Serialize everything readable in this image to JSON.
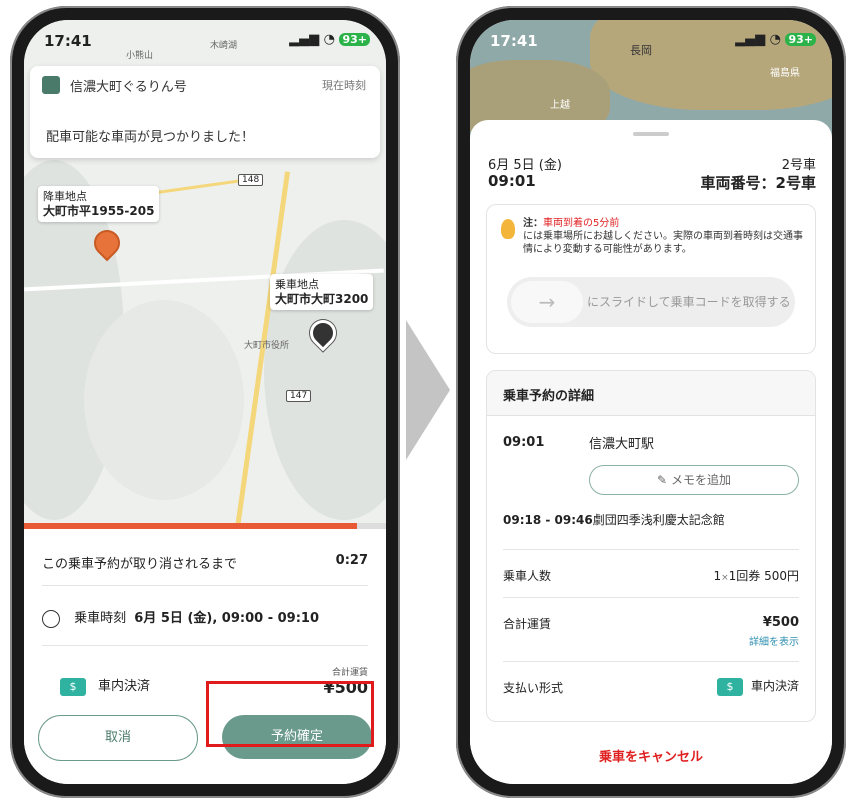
{
  "left_screen": {
    "status_time": "17:41",
    "battery": "93+",
    "map_labels": {
      "top_small": "小熊山",
      "top_small2": "木崎湖",
      "route_148": "148",
      "route_147": "147",
      "townhall": "大町市役所"
    },
    "banner": {
      "app_name": "信濃大町ぐるりん号",
      "current_time_label": "現在時刻",
      "message": "配車可能な車両が見つかりました！"
    },
    "dropoff": {
      "title": "降車地点",
      "address": "大町市平1955-205"
    },
    "pickup": {
      "title": "乗車地点",
      "address": "大町市大町3200"
    },
    "progress_fraction": 0.92,
    "countdown_label": "この乗車予約が取り消されるまで",
    "countdown_value": "0:27",
    "pickup_time_prefix": "乗車時刻",
    "pickup_time_value": "6月 5日 (金), 09:00 - 09:10",
    "payment_icon": "$",
    "payment_method": "車内決済",
    "total_label": "合計運賃",
    "total_value": "¥500",
    "cancel_button": "取消",
    "confirm_button": "予約確定"
  },
  "right_screen": {
    "status_time": "17:41",
    "battery": "93+",
    "map_label1": "長岡",
    "map_label2": "福島県",
    "map_label3": "上越",
    "date": "6月 5日 (金)",
    "time": "09:01",
    "vehicle_short": "2号車",
    "vehicle_full": "車両番号：2号車",
    "note_title": "注：",
    "note_highlight": "車両到着の5分前",
    "note_body": "には乗車場所にお越しください。実際の車両到着時刻は交通事情により変動する可能性があります。",
    "slider_arrow": "→",
    "slider_text": "にスライドして乗車コードを取得する",
    "details_header": "乗車予約の詳細",
    "pickup_time": "09:01",
    "pickup_station": "信濃大町駅",
    "memo_button": "メモを追加",
    "dropoff_time": "09:18 - 09:46",
    "dropoff_place": "劇団四季浅利慶太記念館",
    "passengers_label": "乗車人数",
    "passengers_count": "1",
    "passengers_times": "×",
    "passengers_value": "1回券 500円",
    "total_fare_label": "合計運賃",
    "total_fare_value": "¥500",
    "show_details": "詳細を表示",
    "payment_label": "支払い形式",
    "payment_icon": "$",
    "payment_value": "車内決済",
    "cancel_ride": "乗車をキャンセル"
  }
}
